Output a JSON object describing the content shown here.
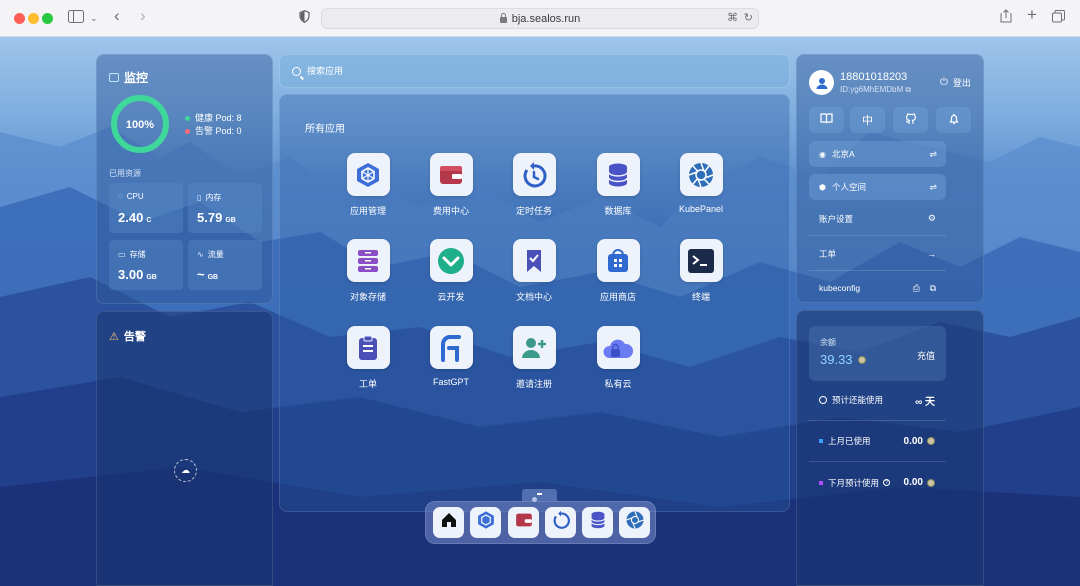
{
  "browser": {
    "url": "bja.sealos.run"
  },
  "monitor": {
    "title": "监控",
    "ring_value": "100%",
    "healthy_label": "健康 Pod: 8",
    "alert_label": "告警 Pod: 0",
    "used_resources_label": "已用资源",
    "cards": [
      {
        "label": "CPU",
        "value": "2.40",
        "unit": "C",
        "icon": "cpu-icon"
      },
      {
        "label": "内存",
        "value": "5.79",
        "unit": "GB",
        "icon": "memory-icon"
      },
      {
        "label": "存储",
        "value": "3.00",
        "unit": "GB",
        "icon": "storage-icon"
      },
      {
        "label": "流量",
        "value": "~",
        "unit": "GB",
        "icon": "traffic-icon"
      }
    ]
  },
  "alerts": {
    "title": "告警"
  },
  "search": {
    "placeholder": "搜索应用"
  },
  "apps": {
    "title": "所有应用",
    "items": [
      {
        "label": "应用管理",
        "icon": "app-management-icon"
      },
      {
        "label": "费用中心",
        "icon": "wallet-icon"
      },
      {
        "label": "定时任务",
        "icon": "cron-icon"
      },
      {
        "label": "数据库",
        "icon": "database-icon"
      },
      {
        "label": "KubePanel",
        "icon": "kubepanel-icon"
      },
      {
        "label": "对象存储",
        "icon": "object-storage-icon"
      },
      {
        "label": "云开发",
        "icon": "cloud-dev-icon"
      },
      {
        "label": "文档中心",
        "icon": "docs-icon"
      },
      {
        "label": "应用商店",
        "icon": "app-store-icon"
      },
      {
        "label": "终端",
        "icon": "terminal-icon"
      },
      {
        "label": "工单",
        "icon": "ticket-icon"
      },
      {
        "label": "FastGPT",
        "icon": "fastgpt-icon"
      },
      {
        "label": "邀请注册",
        "icon": "invite-icon"
      },
      {
        "label": "私有云",
        "icon": "private-cloud-icon"
      }
    ]
  },
  "dock": {
    "items": [
      "home-icon",
      "app-management-icon",
      "wallet-icon",
      "cron-icon",
      "database-icon",
      "kubepanel-icon"
    ]
  },
  "account": {
    "phone": "18801018203",
    "id": "ID:yg6MhEMDbM",
    "logout_label": "登出",
    "lang_label": "中",
    "region": "北京A",
    "workspace": "个人空间",
    "settings_label": "账户设置",
    "ticket_label": "工单",
    "kubeconfig_label": "kubeconfig"
  },
  "balance": {
    "label": "余额",
    "value": "39.33",
    "topup_label": "充值",
    "estimate_label": "预计还能使用",
    "estimate_value": "∞ 天",
    "last_month_label": "上月已使用",
    "last_month_value": "0.00",
    "next_month_label": "下月预计使用",
    "next_month_value": "0.00",
    "last_month_color": "#3b9bff",
    "next_month_color": "#b24dff"
  }
}
